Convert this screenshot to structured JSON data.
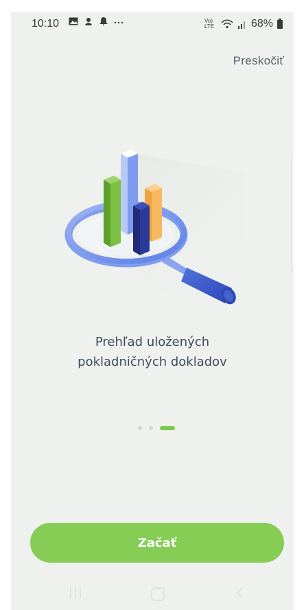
{
  "status_bar": {
    "time": "10:10",
    "left_icons": [
      "image-icon",
      "app-icon",
      "notification-bell-icon",
      "more-icon"
    ],
    "network_label": "Vo) LTE",
    "battery_percent": "68%"
  },
  "header": {
    "skip_label": "Preskočiť"
  },
  "onboarding": {
    "title_line1": "Prehľad uložených",
    "title_line2": "pokladničných dokladov",
    "pages_total": 3,
    "current_page": 3
  },
  "actions": {
    "start_label": "Začať"
  },
  "colors": {
    "accent": "#86cd55",
    "background": "#eff1ef",
    "text": "#3e4c5c"
  },
  "nav_bar": {
    "buttons": [
      "recent-apps",
      "home",
      "back"
    ]
  }
}
